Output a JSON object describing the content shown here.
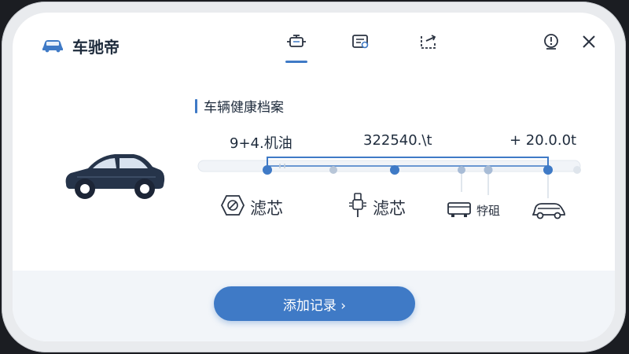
{
  "app": {
    "title": "车驰帝"
  },
  "header": {
    "tabs": [
      {
        "icon": "engine-icon",
        "active": true
      },
      {
        "icon": "document-icon",
        "active": false
      },
      {
        "icon": "share-icon",
        "active": false
      }
    ],
    "actions": [
      {
        "icon": "alert-clock-icon"
      },
      {
        "icon": "close-icon"
      }
    ]
  },
  "section": {
    "title": "车辆健康档案"
  },
  "timeline": {
    "top_labels": [
      "9+4.机油",
      "322540.\\t",
      "+ 20.0.0t"
    ],
    "items": [
      {
        "icon": "filter-icon",
        "label": "滤芯"
      },
      {
        "icon": "spark-plug-icon",
        "label": "滤芯"
      },
      {
        "icon": "battery-icon",
        "label": "牸砠"
      },
      {
        "icon": "car-icon",
        "label": ""
      }
    ]
  },
  "footer": {
    "add_button": "添加记录 ›"
  },
  "colors": {
    "accent": "#3f7ac6",
    "text": "#1f2c3d",
    "muted": "#c3cedb"
  }
}
